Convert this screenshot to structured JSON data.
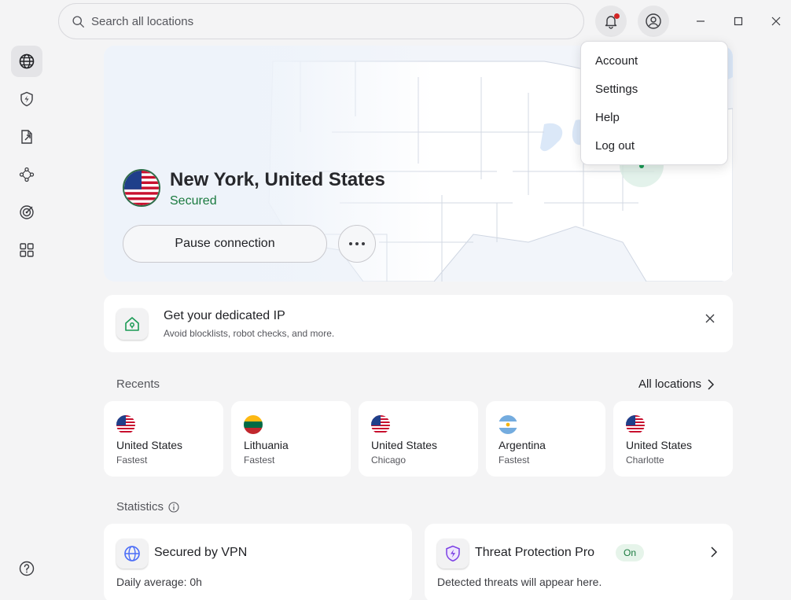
{
  "search": {
    "placeholder": "Search all locations"
  },
  "icons": {
    "search": "search-icon",
    "bell": "bell-icon",
    "profile": "user-icon",
    "minimize": "minimize-icon",
    "maximize": "maximize-icon",
    "close": "close-icon",
    "rail": [
      "globe-icon",
      "shield-bolt-icon",
      "file-share-icon",
      "meshnet-icon",
      "radar-icon",
      "apps-grid-icon",
      "help-icon"
    ]
  },
  "colors": {
    "secured": "#1a7a3f",
    "notification_dot": "#d32424",
    "vpn_accent": "#4a6cf7",
    "threat_accent": "#7b3fe4"
  },
  "connection": {
    "location": "New York, United States",
    "status": "Secured",
    "pause_label": "Pause connection",
    "more_label": "..."
  },
  "account_menu": {
    "items": [
      "Account",
      "Settings",
      "Help",
      "Log out"
    ]
  },
  "promo": {
    "title": "Get your dedicated IP",
    "subtitle": "Avoid blocklists, robot checks, and more."
  },
  "recents": {
    "label": "Recents",
    "all_locations": "All locations",
    "items": [
      {
        "country": "United States",
        "detail": "Fastest",
        "flag": "us"
      },
      {
        "country": "Lithuania",
        "detail": "Fastest",
        "flag": "lt"
      },
      {
        "country": "United States",
        "detail": "Chicago",
        "flag": "us"
      },
      {
        "country": "Argentina",
        "detail": "Fastest",
        "flag": "ar"
      },
      {
        "country": "United States",
        "detail": "Charlotte",
        "flag": "us"
      }
    ]
  },
  "statistics": {
    "label": "Statistics",
    "vpn": {
      "title": "Secured by VPN",
      "daily_label": "Daily average:",
      "daily_value": "0h"
    },
    "threat": {
      "title": "Threat Protection Pro",
      "badge": "On",
      "subtitle": "Detected threats will appear here."
    }
  }
}
